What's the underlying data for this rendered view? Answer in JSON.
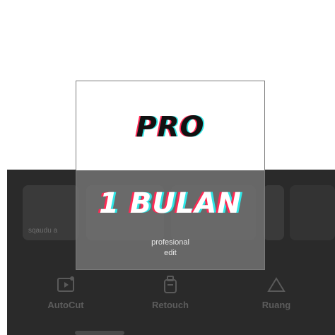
{
  "background_app": {
    "thumbnails": [
      {
        "label": "sqaudu a"
      },
      {
        "label": ""
      },
      {
        "label": ""
      },
      {
        "label": ""
      },
      {
        "label": ""
      }
    ],
    "tools": [
      {
        "label": "AutoCut",
        "icon": "autocut-icon"
      },
      {
        "label": "Retouch",
        "icon": "retouch-icon"
      },
      {
        "label": "Ruang",
        "icon": "ruang-icon"
      }
    ]
  },
  "promo_card": {
    "title": "PRO",
    "duration": "1 BULAN",
    "subtitle_line1": "profesional",
    "subtitle_line2": "edit",
    "colors": {
      "glitch_red": "#ff2a55",
      "glitch_cyan": "#2ee6e6",
      "title_color": "#111111",
      "duration_color": "#ffffff"
    }
  }
}
